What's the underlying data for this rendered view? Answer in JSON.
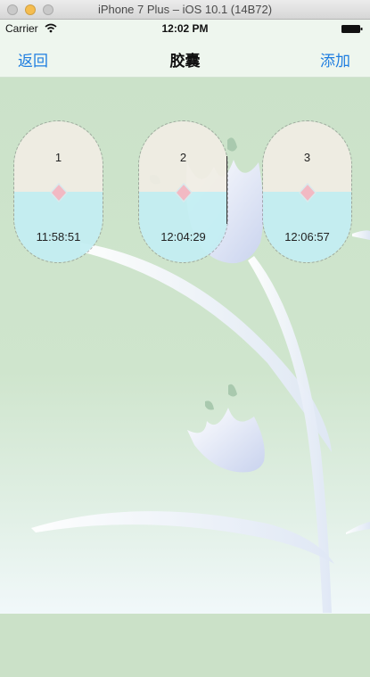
{
  "window": {
    "title": "iPhone 7 Plus – iOS 10.1 (14B72)"
  },
  "status_bar": {
    "carrier": "Carrier",
    "time": "12:02 PM",
    "wifi_icon": "wifi-icon",
    "battery_icon": "battery-icon"
  },
  "nav": {
    "back_label": "返回",
    "title": "胶囊",
    "add_label": "添加"
  },
  "capsules": [
    {
      "number": "1",
      "time": "11:58:51"
    },
    {
      "number": "2",
      "time": "12:04:29"
    },
    {
      "number": "3",
      "time": "12:06:57"
    }
  ],
  "colors": {
    "accent": "#1f7ee0",
    "background": "#cbe1c8",
    "capsule_top": "#f0ede4",
    "capsule_bottom": "#c3eef2",
    "diamond": "#f2b9c3"
  }
}
